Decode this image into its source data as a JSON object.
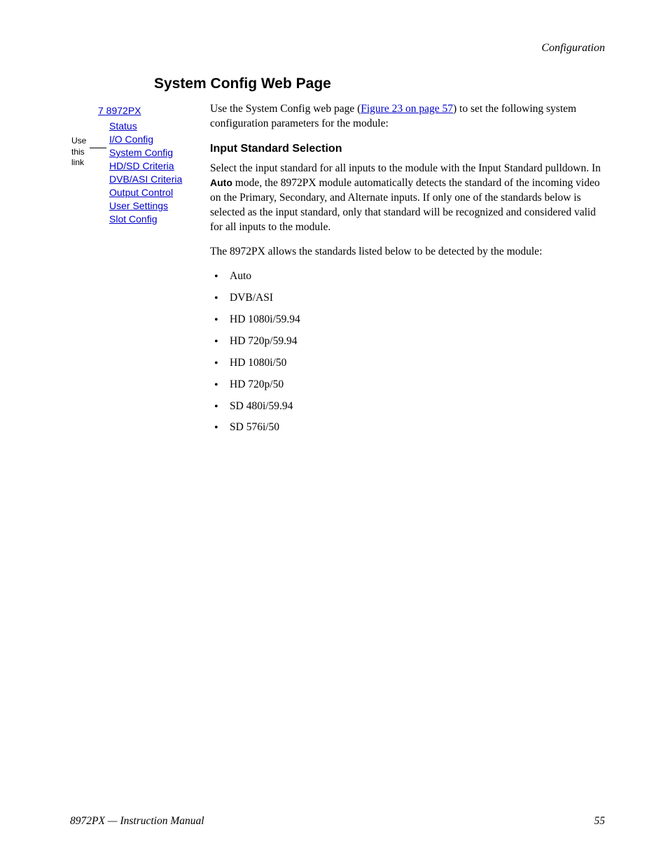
{
  "section_label": "Configuration",
  "heading": "System Config Web Page",
  "nav": {
    "top": "7 8972PX",
    "items": [
      "Status",
      "I/O Config",
      "System Config",
      "HD/SD Criteria",
      "DVB/ASI Criteria",
      "Output Control",
      "User Settings",
      "Slot Config"
    ],
    "annotation": {
      "l1": "Use",
      "l2": "this",
      "l3": "link"
    }
  },
  "intro": {
    "pre": "Use the System Config web page (",
    "link": "Figure 23 on page 57",
    "post": ") to set the following system configuration parameters for the module:"
  },
  "sub_heading": "Input Standard Selection",
  "p1": {
    "a": "Select the input standard for all inputs to the module with the Input Standard pulldown. In ",
    "bold": "Auto",
    "b": " mode, the 8972PX module automatically detects the standard of the incoming video on the Primary, Secondary, and Alternate inputs. If only one of the standards below is selected as the input standard, only that standard will be recognized and considered valid for all inputs to the module."
  },
  "p2": "The 8972PX allows the standards listed below to be detected by the module:",
  "standards": [
    "Auto",
    "DVB/ASI",
    "HD 1080i/59.94",
    "HD 720p/59.94",
    "HD 1080i/50",
    "HD 720p/50",
    "SD 480i/59.94",
    "SD 576i/50"
  ],
  "footer": {
    "left": "8972PX — Instruction Manual",
    "right": "55"
  }
}
